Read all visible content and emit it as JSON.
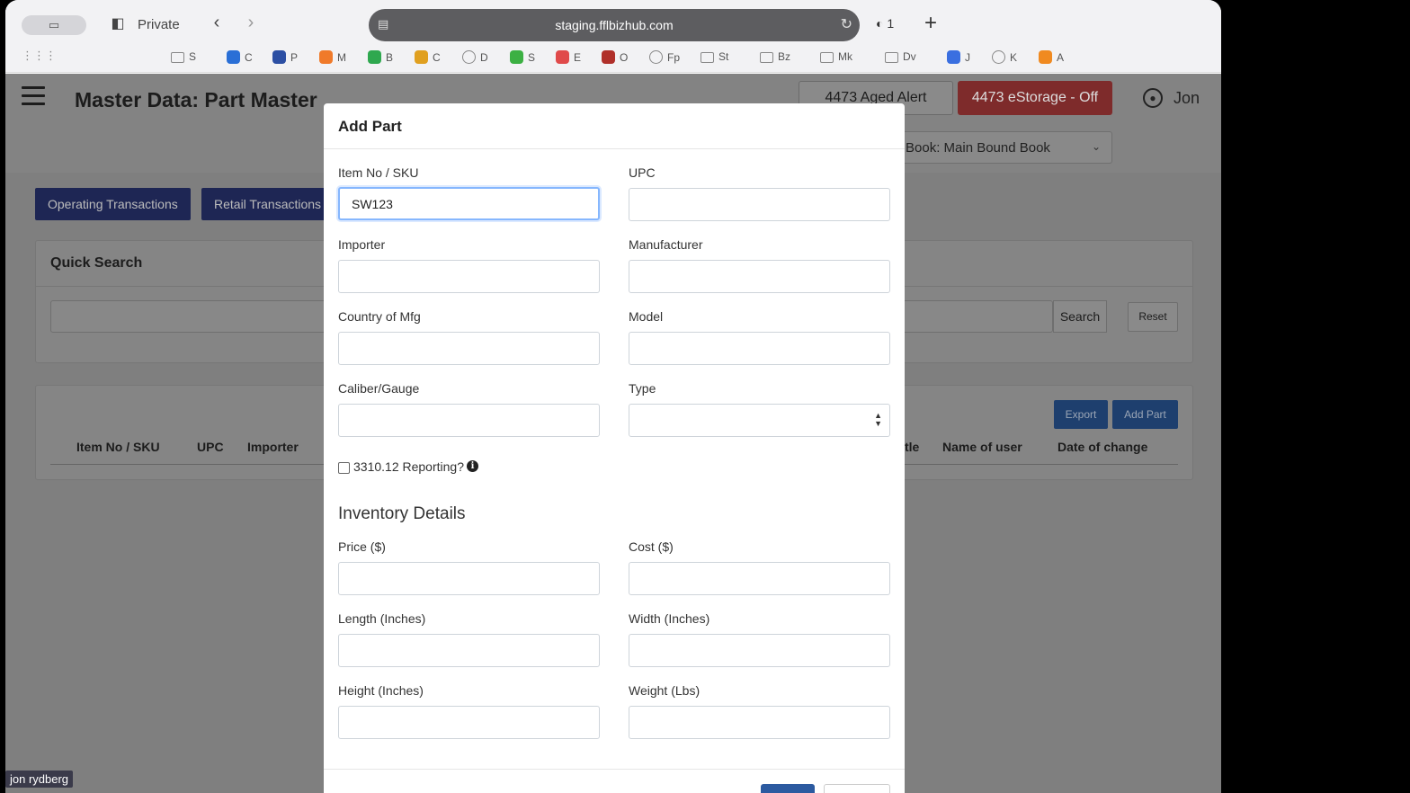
{
  "browser": {
    "private_label": "Private",
    "url": "staging.fflbizhub.com",
    "shield_count": "1",
    "bookmarks": [
      {
        "label": "S",
        "icon": "folder-icon",
        "color": "#888888"
      },
      {
        "label": "C",
        "icon": "site-icon",
        "color": "#2a6fd6"
      },
      {
        "label": "P",
        "icon": "site-icon",
        "color": "#2c4fa3"
      },
      {
        "label": "M",
        "icon": "site-icon",
        "color": "#f07a2a"
      },
      {
        "label": "B",
        "icon": "site-icon",
        "color": "#2fa84f"
      },
      {
        "label": "C",
        "icon": "site-icon",
        "color": "#e0a020"
      },
      {
        "label": "D",
        "icon": "globe-icon",
        "color": "#888888"
      },
      {
        "label": "S",
        "icon": "site-icon",
        "color": "#3cb043"
      },
      {
        "label": "E",
        "icon": "site-icon",
        "color": "#e04a4a"
      },
      {
        "label": "O",
        "icon": "site-icon",
        "color": "#b0302a"
      },
      {
        "label": "Fp",
        "icon": "globe-icon",
        "color": "#888888"
      },
      {
        "label": "St",
        "icon": "folder-icon",
        "color": "#888888"
      },
      {
        "label": "Bz",
        "icon": "folder-icon",
        "color": "#888888"
      },
      {
        "label": "Mk",
        "icon": "folder-icon",
        "color": "#888888"
      },
      {
        "label": "Dv",
        "icon": "folder-icon",
        "color": "#888888"
      },
      {
        "label": "J",
        "icon": "site-icon",
        "color": "#3a6fe0"
      },
      {
        "label": "K",
        "icon": "globe-icon",
        "color": "#888888"
      },
      {
        "label": "A",
        "icon": "site-icon",
        "color": "#f08a20"
      }
    ]
  },
  "header": {
    "title": "Master Data: Part Master",
    "aged_alert": "4473 Aged Alert",
    "estorage": "4473 eStorage - Off",
    "user": "Jon",
    "book": "Book: Main Bound Book"
  },
  "tabs": {
    "operating": "Operating Transactions",
    "retail": "Retail Transactions"
  },
  "quick_search": {
    "title": "Quick Search",
    "search": "Search",
    "reset": "Reset"
  },
  "table": {
    "export": "Export",
    "add_part": "Add Part",
    "columns_left": [
      "Item No / SKU",
      "UPC",
      "Importer"
    ],
    "columns_right": [
      "tle",
      "Name of user",
      "Date of change"
    ]
  },
  "modal": {
    "title": "Add Part",
    "fields": {
      "sku": {
        "label": "Item No / SKU",
        "value": "SW123"
      },
      "upc": {
        "label": "UPC",
        "value": ""
      },
      "importer": {
        "label": "Importer",
        "value": ""
      },
      "manufacturer": {
        "label": "Manufacturer",
        "value": ""
      },
      "country": {
        "label": "Country of Mfg",
        "value": ""
      },
      "model": {
        "label": "Model",
        "value": ""
      },
      "caliber": {
        "label": "Caliber/Gauge",
        "value": ""
      },
      "type": {
        "label": "Type",
        "value": ""
      },
      "price": {
        "label": "Price ($)",
        "value": ""
      },
      "cost": {
        "label": "Cost ($)",
        "value": ""
      },
      "length": {
        "label": "Length (Inches)",
        "value": ""
      },
      "width": {
        "label": "Width (Inches)",
        "value": ""
      },
      "height": {
        "label": "Height (Inches)",
        "value": ""
      },
      "weight": {
        "label": "Weight (Lbs)",
        "value": ""
      }
    },
    "reporting_label": "3310.12 Reporting?",
    "inventory_title": "Inventory Details"
  },
  "video_name_tag": "jon rydberg"
}
